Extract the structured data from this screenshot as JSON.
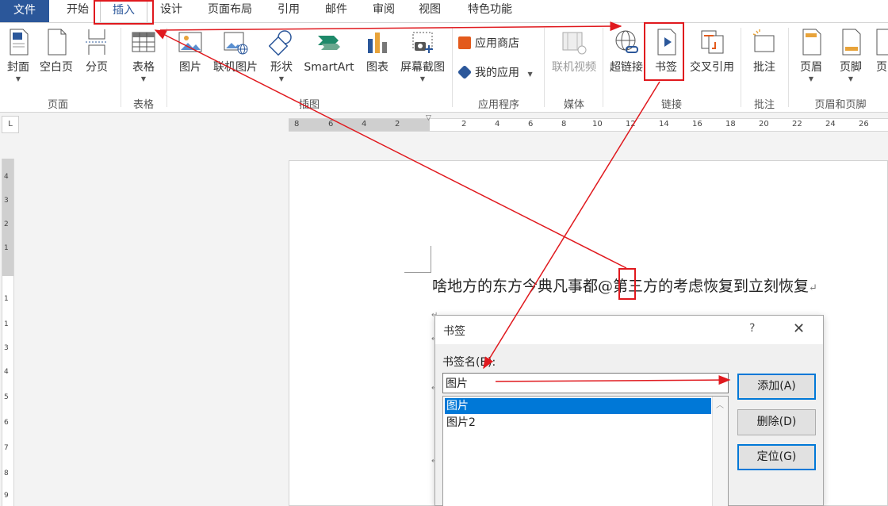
{
  "tabs": {
    "file": "文件",
    "items": [
      "开始",
      "插入",
      "设计",
      "页面布局",
      "引用",
      "邮件",
      "审阅",
      "视图",
      "特色功能"
    ]
  },
  "ribbon": {
    "buttons": {
      "cover": "封面",
      "blank_page": "空白页",
      "page_break": "分页",
      "table": "表格",
      "picture": "图片",
      "online_picture": "联机图片",
      "shapes": "形状",
      "smartart": "SmartArt",
      "chart": "图表",
      "screenshot": "屏幕截图",
      "app_store": "应用商店",
      "my_apps": "我的应用",
      "online_video": "联机视频",
      "hyperlink": "超链接",
      "bookmark": "书签",
      "cross_reference": "交叉引用",
      "comment": "批注",
      "header": "页眉",
      "footer": "页脚",
      "page_number": "页"
    },
    "groups": {
      "pages": "页面",
      "tables": "表格",
      "illustrations": "插图",
      "apps": "应用程序",
      "media": "媒体",
      "links": "链接",
      "comments": "批注",
      "header_footer": "页眉和页脚"
    }
  },
  "ruler": {
    "corner": "L",
    "left_ticks": [
      "8",
      "6",
      "4",
      "2"
    ],
    "right_ticks": [
      "2",
      "4",
      "6",
      "8",
      "10",
      "12",
      "14",
      "16",
      "18",
      "20",
      "22",
      "24",
      "26"
    ],
    "vertical_ticks": [
      "4",
      "3",
      "2",
      "1",
      "1",
      "1",
      "2",
      "3",
      "4",
      "5",
      "6",
      "7",
      "8",
      "9"
    ]
  },
  "document": {
    "text_before": "啥地方的东方今典凡事都",
    "insertion": "@",
    "text_after": "第三方的考虑恢复到立刻恢复",
    "para_mark": "↵"
  },
  "dialog": {
    "title": "书签",
    "help": "?",
    "close": "✕",
    "name_label": "书签名(B):",
    "name_value": "图片",
    "list": [
      "图片",
      "图片2"
    ],
    "buttons": {
      "add": "添加(A)",
      "delete": "删除(D)",
      "goto": "定位(G)"
    }
  },
  "colors": {
    "accent": "#2b579a",
    "annotation": "#e0191e",
    "selection": "#0078d7"
  }
}
